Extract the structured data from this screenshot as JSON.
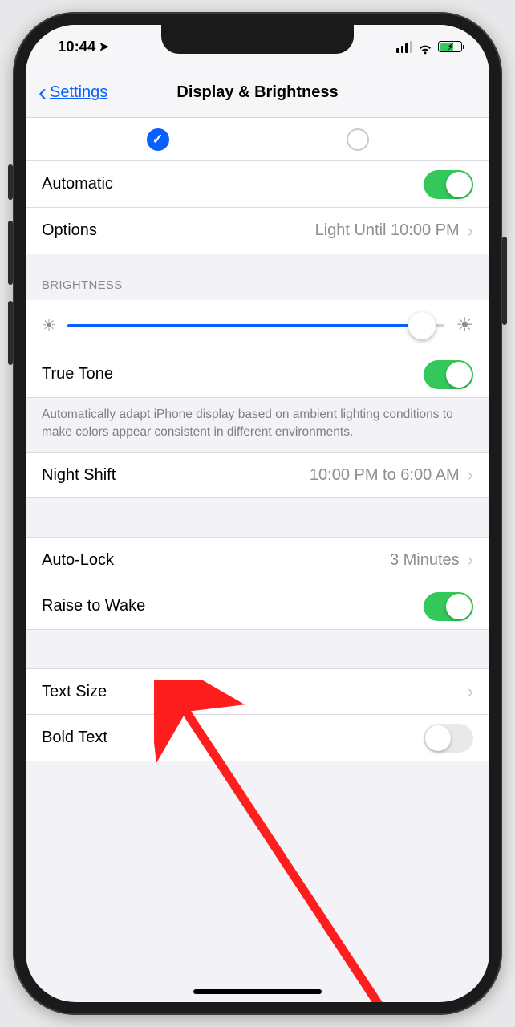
{
  "statusbar": {
    "time": "10:44"
  },
  "nav": {
    "back": "Settings",
    "title": "Display & Brightness"
  },
  "appearance": {
    "automatic_label": "Automatic",
    "automatic_on": true,
    "options_label": "Options",
    "options_value": "Light Until 10:00 PM"
  },
  "brightness": {
    "header": "BRIGHTNESS",
    "truetone_label": "True Tone",
    "truetone_on": true,
    "truetone_note": "Automatically adapt iPhone display based on ambient lighting conditions to make colors appear consistent in different environments."
  },
  "nightshift": {
    "label": "Night Shift",
    "value": "10:00 PM to 6:00 AM"
  },
  "autolock": {
    "label": "Auto-Lock",
    "value": "3 Minutes"
  },
  "raisetowake": {
    "label": "Raise to Wake",
    "on": true
  },
  "textsize": {
    "label": "Text Size"
  },
  "boldtext": {
    "label": "Bold Text",
    "on": false
  }
}
